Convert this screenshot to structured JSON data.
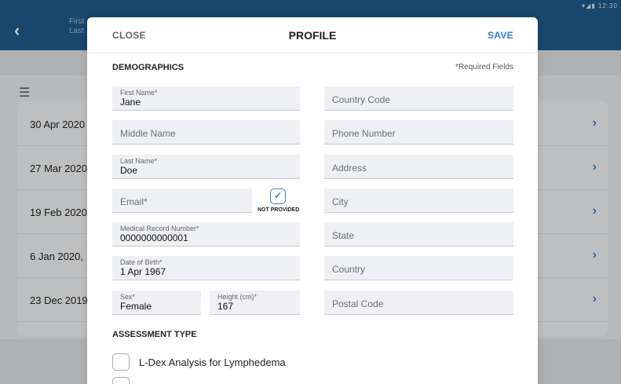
{
  "status": {
    "time": "12:30",
    "icons": "▾◢▮"
  },
  "header": {
    "back_icon": "chevron-left-icon",
    "name_first": "First",
    "name_last": "Last"
  },
  "list": {
    "rows": [
      {
        "date": "30 Apr 2020"
      },
      {
        "date": "27 Mar 2020"
      },
      {
        "date": "19 Feb 2020,"
      },
      {
        "date": "6 Jan 2020, "
      },
      {
        "date": "23 Dec 2019"
      }
    ]
  },
  "modal": {
    "close_label": "CLOSE",
    "title": "PROFILE",
    "save_label": "SAVE",
    "demographics": {
      "title": "DEMOGRAPHICS",
      "required_note": "*Required Fields",
      "first_name": {
        "label": "First Name*",
        "value": "Jane"
      },
      "middle_name": {
        "placeholder": "Middle Name"
      },
      "last_name": {
        "label": "Last Name*",
        "value": "Doe"
      },
      "email": {
        "placeholder": "Email*"
      },
      "not_provided": {
        "label": "NOT PROVIDED",
        "checked": true
      },
      "mrn": {
        "label": "Medical Record Number*",
        "value": "0000000000001"
      },
      "dob": {
        "label": "Date of Birth*",
        "value": "1 Apr 1967"
      },
      "sex": {
        "label": "Sex*",
        "value": "Female"
      },
      "height": {
        "label": "Height (cm)*",
        "value": "167"
      },
      "country_code": {
        "placeholder": "Country Code"
      },
      "phone": {
        "placeholder": "Phone Number"
      },
      "address": {
        "placeholder": "Address"
      },
      "city": {
        "placeholder": "City"
      },
      "state": {
        "placeholder": "State"
      },
      "country": {
        "placeholder": "Country"
      },
      "postal_code": {
        "placeholder": "Postal Code"
      }
    },
    "assessment": {
      "title": "ASSESSMENT TYPE",
      "options": [
        {
          "label": "L-Dex Analysis for Lymphedema",
          "checked": false
        }
      ]
    }
  },
  "colors": {
    "accent": "#2f7fc9",
    "header": "#1f5a8c"
  }
}
